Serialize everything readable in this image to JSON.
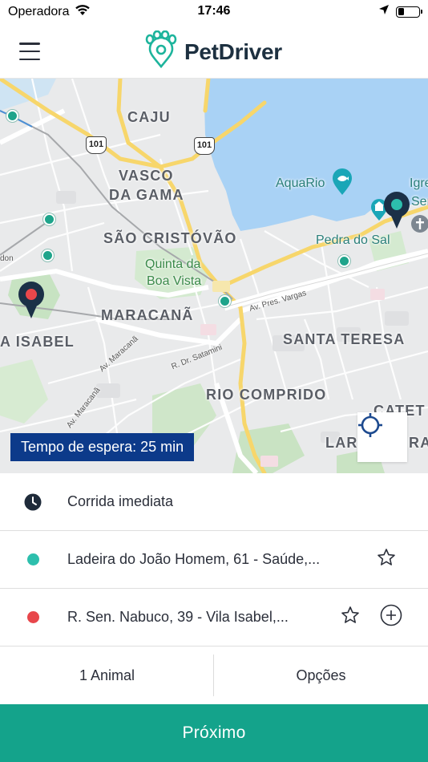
{
  "status_bar": {
    "carrier": "Operadora",
    "time": "17:46",
    "battery_level": 0.3
  },
  "header": {
    "app_name": "PetDriver",
    "brand_color": "#1db49c",
    "text_color": "#1d3040"
  },
  "map": {
    "labels": {
      "caju": "CAJU",
      "vasco": "VASCO",
      "da_gama": "DA GAMA",
      "sao_cristovao": "SÃO CRISTÓVÃO",
      "quinta": "Quinta da",
      "boa_vista": "Boa Vista",
      "maracana": "MARACANÃ",
      "vila_isabel": "A ISABEL",
      "santa_teresa": "SANTA TERESA",
      "rio_comprido": "RIO COMPRIDO",
      "aquario": "AquaRio",
      "pedra_do_sal": "Pedra do Sal",
      "igreja_1": "Igre",
      "igreja_2": "Ser",
      "catete": "CATET",
      "laranjeiras_left": "LAR",
      "laranjeiras_right": "RA",
      "don": "don",
      "av_pres_vargas": "Av. Pres. Vargas",
      "av_maracana_1": "Av. Maracanã",
      "av_maracana_2": "Av. Maracanã",
      "r_dr_satamini": "R. Dr. Satamini"
    },
    "highway_shields": [
      "101",
      "101"
    ],
    "origin_pin_color": "#2dbfad",
    "destination_pin_color": "#e8474b",
    "wait_badge": "Tempo de espera: 25 min"
  },
  "trip": {
    "mode_label": "Corrida imediata",
    "origin": "Ladeira do João Homem, 61 - Saúde,...",
    "destination": "R. Sen. Nabuco, 39 - Vila Isabel,..."
  },
  "bottom": {
    "animals_label": "1 Animal",
    "options_label": "Opções",
    "next_label": "Próximo"
  }
}
